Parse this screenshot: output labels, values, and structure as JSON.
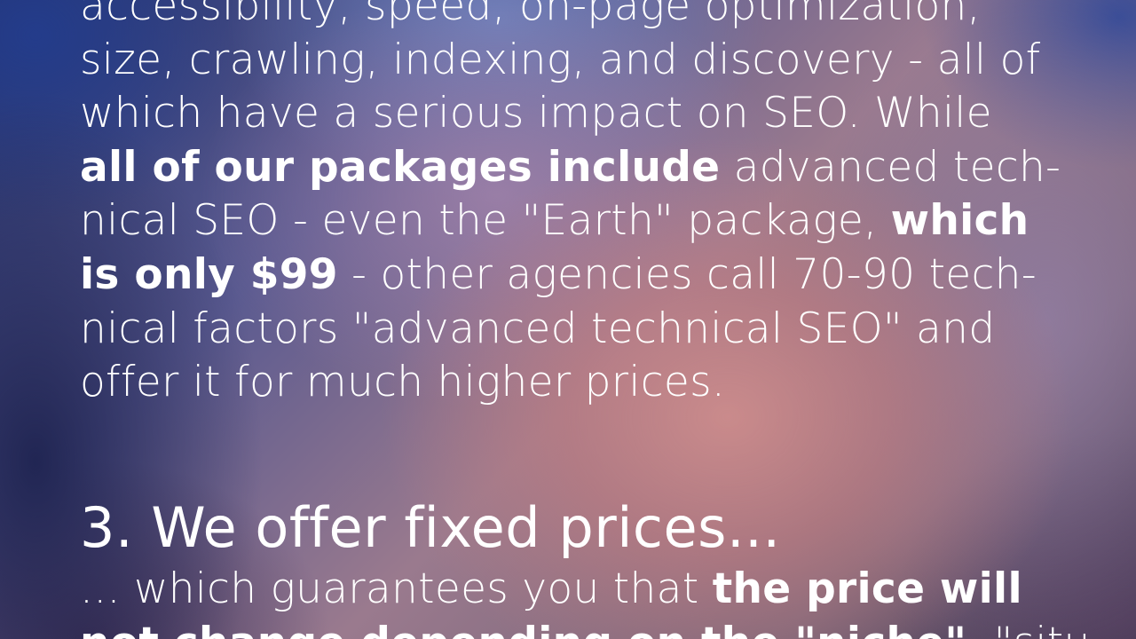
{
  "paragraph": {
    "l1": "accessibility, speed, on-page optimization,",
    "l2": "size, crawling, indexing, and discovery - all of",
    "l3": "which have a serious impact on SEO. While",
    "l4_bold": "all of our packages include",
    "l4_rest": " advanced tech-",
    "l5_pre": "nical SEO - even the \"Earth\" package, ",
    "l5_bold": "which",
    "l6_bold": "is only $99",
    "l6_rest": " - other agencies call 70-90 tech-",
    "l7": "nical factors \"advanced technical SEO\" and",
    "l8": "offer it for much higher prices."
  },
  "section3": {
    "heading": "3. We offer fixed prices...",
    "l1_pre": "... which guarantees you that ",
    "l1_bold": "the price will",
    "l2_bold": "not change depending on the \"niche\"",
    "l2_rest": ", \"situ"
  }
}
